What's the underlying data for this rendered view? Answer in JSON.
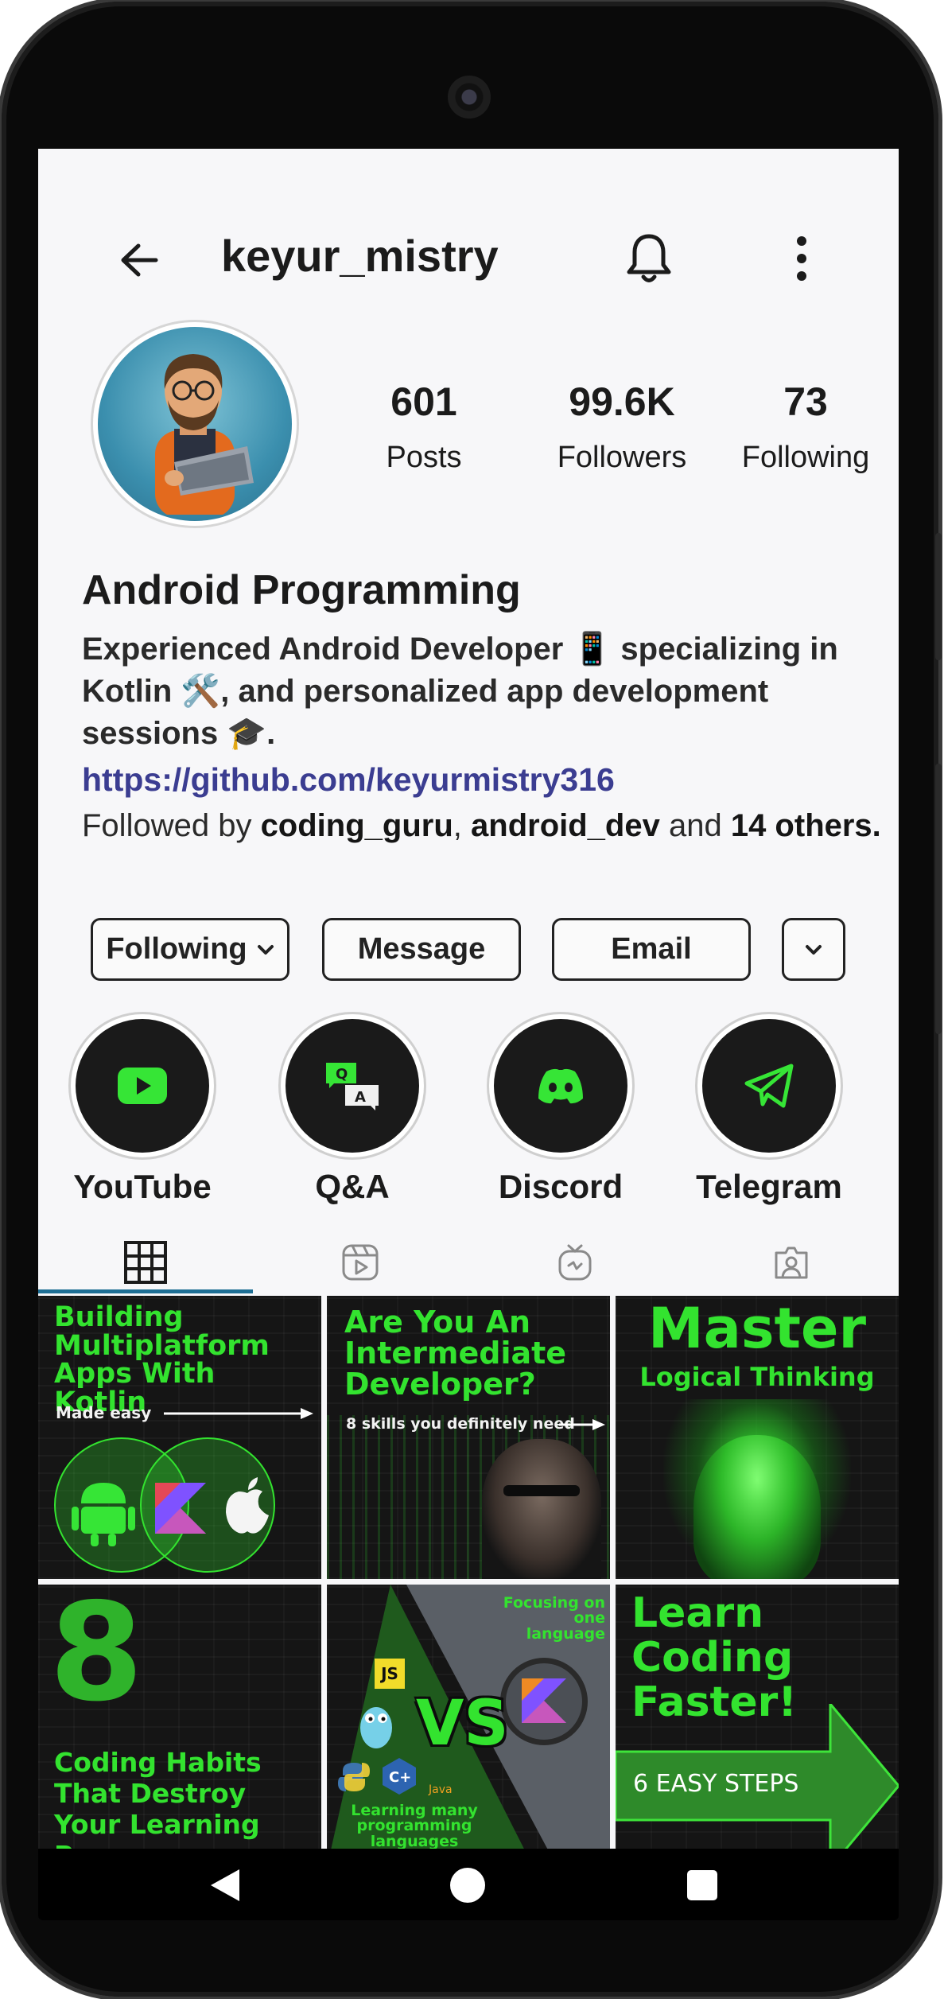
{
  "header": {
    "username": "keyur_mistry",
    "back_icon": "arrow-left-icon",
    "bell_icon": "bell-icon",
    "menu_icon": "more-vertical-icon"
  },
  "profile": {
    "stats": [
      {
        "value": "601",
        "label": "Posts"
      },
      {
        "value": "99.6K",
        "label": "Followers"
      },
      {
        "value": "73",
        "label": "Following"
      }
    ],
    "name": "Android Programming",
    "bio": "Experienced Android Developer 📱 specializing in Kotlin 🛠️, and personalized app development sessions 🎓.",
    "link": "https://github.com/keyurmistry316",
    "followed_by": {
      "prefix": "Followed by ",
      "user1": "coding_guru",
      "sep": ", ",
      "user2": "android_dev",
      "and": " and ",
      "others": "14 others."
    }
  },
  "actions": {
    "following": "Following",
    "message": "Message",
    "email": "Email"
  },
  "highlights": [
    {
      "label": "YouTube",
      "icon": "youtube-icon"
    },
    {
      "label": "Q&A",
      "icon": "qa-icon"
    },
    {
      "label": "Discord",
      "icon": "discord-icon"
    },
    {
      "label": "Telegram",
      "icon": "telegram-icon"
    }
  ],
  "tabs": [
    {
      "icon": "grid-icon",
      "active": true
    },
    {
      "icon": "reels-icon",
      "active": false
    },
    {
      "icon": "igtv-icon",
      "active": false
    },
    {
      "icon": "tagged-icon",
      "active": false
    }
  ],
  "posts": [
    {
      "title": "Building Multiplatform Apps With Kotlin",
      "subtitle": "Made easy"
    },
    {
      "title": "Are You An Intermediate Developer?",
      "subtitle": "8 skills you definitely need"
    },
    {
      "title_big": "Master",
      "title": "Logical Thinking"
    },
    {
      "big": "8",
      "title": "Coding Habits That Destroy Your Learning Process"
    },
    {
      "top": "Focusing on one language",
      "vs": "VS",
      "bottom": "Learning many programming languages",
      "js": "JS",
      "java": "Java"
    },
    {
      "title": "Learn Coding Faster!",
      "subtitle": "6 EASY STEPS"
    }
  ],
  "colors": {
    "accent_green": "#33e32f",
    "link": "#3b3d91",
    "tab_indicator": "#1e6f95",
    "highlight_bg": "#1a1a1a"
  }
}
